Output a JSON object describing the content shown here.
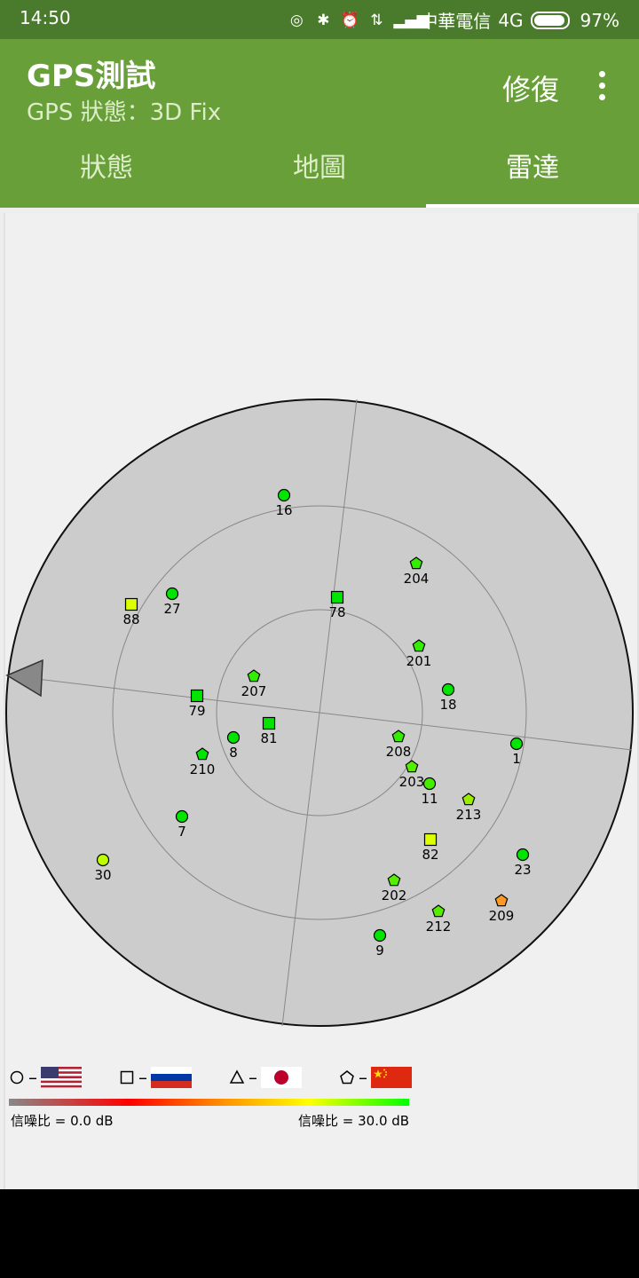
{
  "status_bar": {
    "time": "14:50",
    "carrier": "中華電信",
    "network": "4G",
    "battery": "97%"
  },
  "app_bar": {
    "title": "GPS測試",
    "subtitle": "GPS 狀態：3D Fix",
    "action_label": "修復"
  },
  "tabs": [
    {
      "label": "狀態",
      "active": false
    },
    {
      "label": "地圖",
      "active": false
    },
    {
      "label": "雷達",
      "active": true
    }
  ],
  "satellites": [
    {
      "id": "16",
      "shape": "circle",
      "color": "#00e600"
    },
    {
      "id": "204",
      "shape": "pentagon",
      "color": "#33ee00"
    },
    {
      "id": "27",
      "shape": "circle",
      "color": "#00e600"
    },
    {
      "id": "88",
      "shape": "square",
      "color": "#ddff00"
    },
    {
      "id": "78",
      "shape": "square",
      "color": "#00e600"
    },
    {
      "id": "201",
      "shape": "pentagon",
      "color": "#33ee00"
    },
    {
      "id": "207",
      "shape": "pentagon",
      "color": "#33ee00"
    },
    {
      "id": "18",
      "shape": "circle",
      "color": "#00e600"
    },
    {
      "id": "79",
      "shape": "square",
      "color": "#00e600"
    },
    {
      "id": "81",
      "shape": "square",
      "color": "#00e600"
    },
    {
      "id": "8",
      "shape": "circle",
      "color": "#00e600"
    },
    {
      "id": "208",
      "shape": "pentagon",
      "color": "#33ee00"
    },
    {
      "id": "1",
      "shape": "circle",
      "color": "#00e600"
    },
    {
      "id": "210",
      "shape": "pentagon",
      "color": "#00e600"
    },
    {
      "id": "203",
      "shape": "pentagon",
      "color": "#55ee00"
    },
    {
      "id": "11",
      "shape": "circle",
      "color": "#44ee00"
    },
    {
      "id": "213",
      "shape": "pentagon",
      "color": "#99ee00"
    },
    {
      "id": "7",
      "shape": "circle",
      "color": "#00e600"
    },
    {
      "id": "82",
      "shape": "square",
      "color": "#ddff00"
    },
    {
      "id": "23",
      "shape": "circle",
      "color": "#00e600"
    },
    {
      "id": "30",
      "shape": "circle",
      "color": "#bbff00"
    },
    {
      "id": "202",
      "shape": "pentagon",
      "color": "#55ee00"
    },
    {
      "id": "212",
      "shape": "pentagon",
      "color": "#55ee00"
    },
    {
      "id": "209",
      "shape": "pentagon",
      "color": "#ff9922"
    },
    {
      "id": "9",
      "shape": "circle",
      "color": "#00e600"
    }
  ],
  "legend": {
    "items": [
      {
        "shape": "circle",
        "flag": "us-flag-icon",
        "dash": "–"
      },
      {
        "shape": "square",
        "flag": "russia-flag-icon",
        "dash": "–"
      },
      {
        "shape": "triangle",
        "flag": "japan-flag-icon",
        "dash": "–"
      },
      {
        "shape": "pentagon",
        "flag": "china-flag-icon",
        "dash": "–"
      }
    ],
    "snr_min_label": "信噪比 = 0.0 dB",
    "snr_max_label": "信噪比 = 30.0 dB"
  }
}
